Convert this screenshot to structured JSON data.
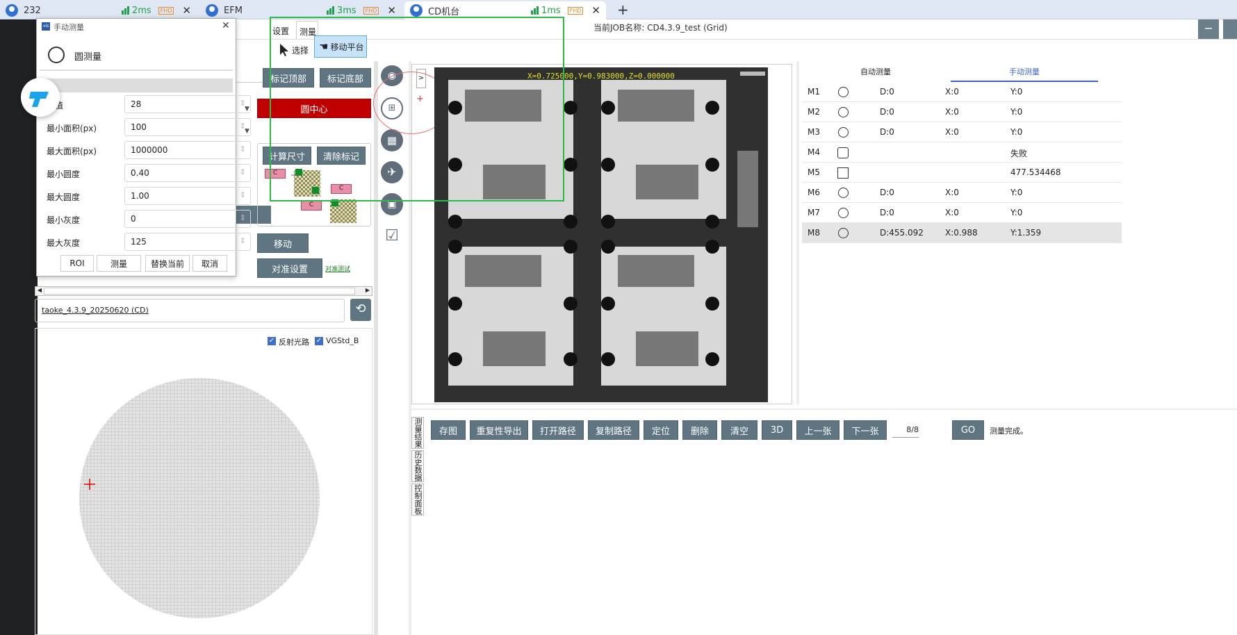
{
  "browser_tabs": [
    {
      "label": "232",
      "latency": "2ms",
      "badge": "FHD"
    },
    {
      "label": "EFM",
      "latency": "3ms",
      "badge": "FHD"
    },
    {
      "label": "CD机台",
      "latency": "1ms",
      "badge": "FHD"
    }
  ],
  "new_tab_label": "+",
  "menu": {
    "settings": "设置",
    "measure": "测量"
  },
  "job_title": "当前JOB名称:  CD4.3.9_test (Grid)",
  "toolbar": {
    "select": "选择",
    "move_stage": "移动平台"
  },
  "mark_buttons": {
    "top": "标记顶部",
    "bottom": "标记底部",
    "circle_center": "圆中心",
    "calc_size": "计算尺寸",
    "clear_marks": "清除标记",
    "move": "移动",
    "align_settings": "对准设置",
    "overlay_test": "对准测试"
  },
  "marker_labels": [
    "C",
    "C",
    "C"
  ],
  "recipe_path": "taoke_4.3.9_20250620 (CD)",
  "wafer": {
    "reflect_label": "反射光路",
    "reflect_checked": true,
    "vgstd_label": "VGStd_B",
    "vgstd_checked": true
  },
  "image": {
    "coord_readout": "X=0.725000,Y=0.983000,Z=0.000000",
    "nav_button": ">"
  },
  "result_tabs": {
    "auto": "自动测量",
    "manual": "手动测量"
  },
  "results": [
    {
      "name": "M1",
      "icon": "circle",
      "d": "D:0",
      "x": "X:0",
      "y": "Y:0"
    },
    {
      "name": "M2",
      "icon": "circle",
      "d": "D:0",
      "x": "X:0",
      "y": "Y:0"
    },
    {
      "name": "M3",
      "icon": "circle",
      "d": "D:0",
      "x": "X:0",
      "y": "Y:0"
    },
    {
      "name": "M4",
      "icon": "frame",
      "d": "",
      "x": "",
      "y": "失败"
    },
    {
      "name": "M5",
      "icon": "gap",
      "d": "",
      "x": "",
      "y": "477.534468"
    },
    {
      "name": "M6",
      "icon": "circle",
      "d": "D:0",
      "x": "X:0",
      "y": "Y:0"
    },
    {
      "name": "M7",
      "icon": "circle",
      "d": "D:0",
      "x": "X:0",
      "y": "Y:0"
    },
    {
      "name": "M8",
      "icon": "circle",
      "d": "D:455.092",
      "x": "X:0.988",
      "y": "Y:1.359"
    }
  ],
  "bottom_buttons": [
    "存图",
    "重复性导出",
    "打开路径",
    "复制路径",
    "定位",
    "删除",
    "清空",
    "3D",
    "上一张",
    "下一张"
  ],
  "page_counter": "8/8",
  "go_button": "GO",
  "status_text": "测量完成。",
  "side_tabs": [
    "测量结果",
    "历史数据",
    "控制面板"
  ],
  "dialog": {
    "title": "手动测量",
    "mode_label": "圆测量",
    "fields": [
      {
        "label": "阈值",
        "value": "28"
      },
      {
        "label": "最小面积(px)",
        "value": "100"
      },
      {
        "label": "最大面积(px)",
        "value": "1000000"
      },
      {
        "label": "最小圆度",
        "value": "0.40"
      },
      {
        "label": "最大圆度",
        "value": "1.00"
      },
      {
        "label": "最小灰度",
        "value": "0"
      },
      {
        "label": "最大灰度",
        "value": "125"
      }
    ],
    "buttons": {
      "roi": "ROI",
      "measure": "测量",
      "replace": "替换当前",
      "cancel": "取消"
    }
  },
  "colors": {
    "accent_red": "#c00000",
    "button_gray": "#5f7582",
    "tab_blue": "#3a62c9",
    "highlight_green": "#2db84a"
  }
}
